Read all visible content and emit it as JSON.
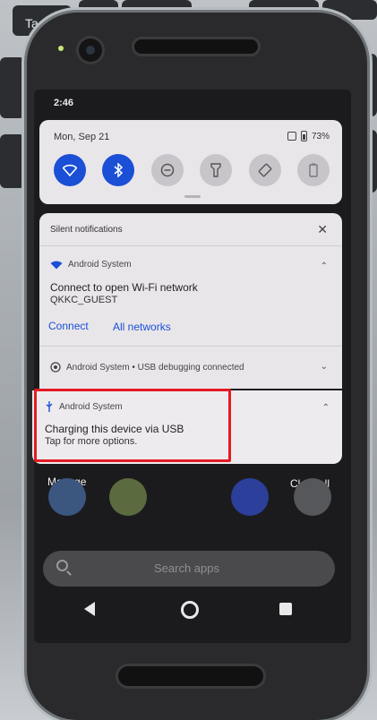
{
  "background": {
    "keyboard_label": "Ta"
  },
  "status_bar": {
    "time": "2:46"
  },
  "quick_settings": {
    "date": "Mon, Sep 21",
    "battery": "73%",
    "tiles": [
      {
        "icon": "wifi-icon",
        "on": true
      },
      {
        "icon": "bluetooth-icon",
        "on": true
      },
      {
        "icon": "dnd-icon",
        "on": false
      },
      {
        "icon": "flashlight-icon",
        "on": false
      },
      {
        "icon": "auto-rotate-icon",
        "on": false
      },
      {
        "icon": "battery-saver-icon",
        "on": false
      }
    ]
  },
  "notifications": {
    "section_label": "Silent notifications",
    "wifi": {
      "app": "Android System",
      "title": "Connect to open Wi-Fi network",
      "ssid": "QKKC_GUEST",
      "action_connect": "Connect",
      "action_all": "All networks"
    },
    "usb_debug": {
      "app": "Android System",
      "summary": "Android System • USB debugging connected"
    },
    "usb_charge": {
      "app": "Android System",
      "title": "Charging this device via USB",
      "subtitle": "Tap for more options."
    }
  },
  "home": {
    "manage": "Manage",
    "clear_all": "Clear all",
    "search_placeholder": "Search apps"
  },
  "colors": {
    "accent": "#1a4fd6",
    "highlight": "#e31b23"
  }
}
